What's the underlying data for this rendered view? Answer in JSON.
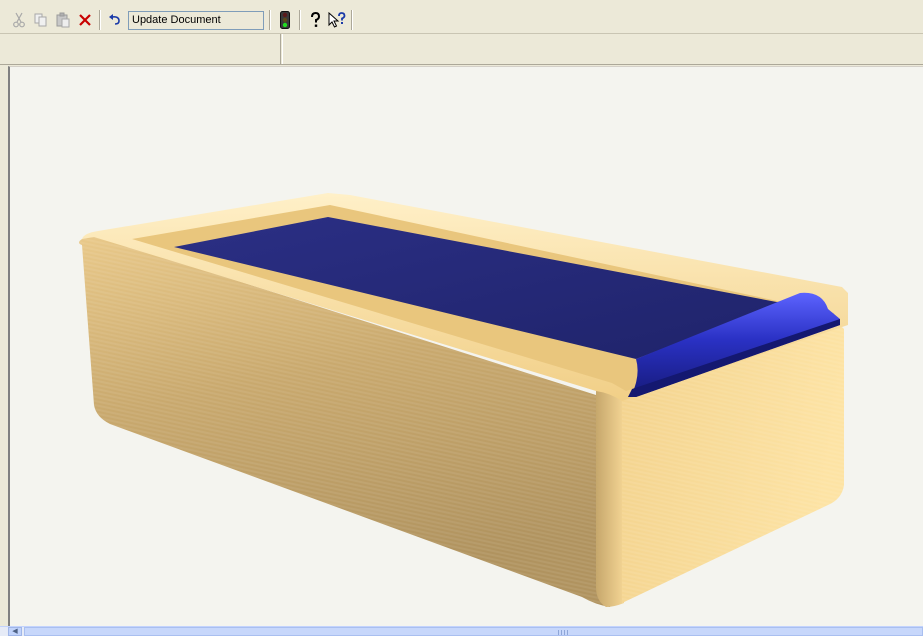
{
  "toolbar": {
    "cut_icon": "scissors-icon",
    "copy_icon": "copy-icon",
    "paste_icon": "paste-icon",
    "delete_icon": "delete-x-icon",
    "undo_icon": "undo-arrow-icon",
    "command_box_text": "Update Document",
    "traffic_light_icon": "traffic-light-icon",
    "help_icon": "question-mark-icon",
    "context_help_icon": "pointer-question-icon"
  },
  "viewport": {
    "model_colors": {
      "body": "#f3cf86",
      "body_shadow": "#b89a62",
      "lid": "#262a78",
      "lid_edge": "#2f35b8"
    },
    "background": "#f4f4ef"
  },
  "scrollbar": {
    "left_arrow_icon": "chevron-left-icon"
  }
}
